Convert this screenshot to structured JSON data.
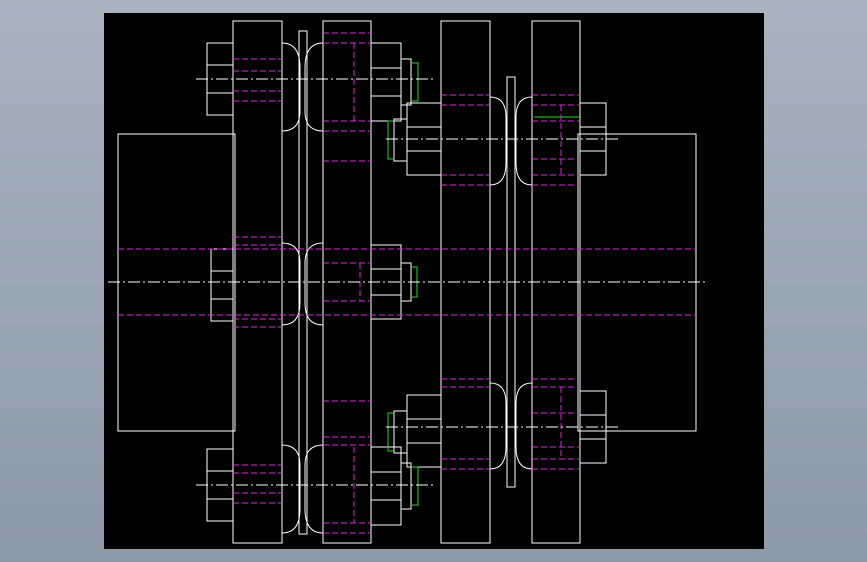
{
  "drawing": {
    "colors": {
      "background": "#000000",
      "outline": "#ffffff",
      "hidden_line": "#e020e0",
      "center_line": "#ffffff",
      "accent": "#22dd22",
      "window_frame": "#9aa4b1"
    },
    "view": "cad-drawing-flange-coupling",
    "line_styles": {
      "hidden": "dashed",
      "center": "dash-dot"
    }
  }
}
